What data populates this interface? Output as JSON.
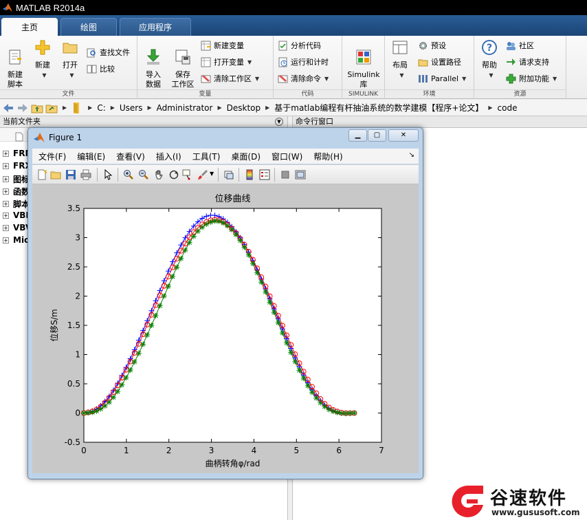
{
  "app": {
    "title": "MATLAB R2014a"
  },
  "tabs": [
    {
      "label": "主页"
    },
    {
      "label": "绘图"
    },
    {
      "label": "应用程序"
    }
  ],
  "ribbon": {
    "file": {
      "label": "文件",
      "new_script": "新建\n脚本",
      "new": "新建",
      "open": "打开",
      "find_files": "查找文件",
      "compare": "比较"
    },
    "variable": {
      "label": "变量",
      "import_data": "导入\n数据",
      "save_workspace": "保存\n工作区",
      "new_variable": "新建变量",
      "open_variable": "打开变量",
      "clear_workspace": "清除工作区"
    },
    "code": {
      "label": "代码",
      "analyze_code": "分析代码",
      "run_and_time": "运行和计时",
      "clear_commands": "清除命令"
    },
    "simulink": {
      "label": "SIMULINK",
      "simulink_library": "Simulink\n库"
    },
    "environment": {
      "label": "环境",
      "layout": "布局",
      "preferences": "预设",
      "set_path": "设置路径",
      "parallel": "Parallel"
    },
    "resources": {
      "label": "资源",
      "help": "帮助",
      "community": "社区",
      "request_support": "请求支持",
      "addons": "附加功能"
    }
  },
  "address": {
    "path": [
      "C:",
      "Users",
      "Administrator",
      "Desktop",
      "基于matlab编程有杆抽油系统的数学建模【程序+论文】",
      "code"
    ]
  },
  "current_folder": {
    "title": "当前文件夹",
    "items": [
      "FRM",
      "FRX",
      "图标",
      "函数",
      "脚本",
      "VBF",
      "VBV",
      "Mic"
    ]
  },
  "command_window": {
    "title": "命令行窗口"
  },
  "figure": {
    "title": "Figure 1",
    "menu": [
      "文件(F)",
      "编辑(E)",
      "查看(V)",
      "插入(I)",
      "工具(T)",
      "桌面(D)",
      "窗口(W)",
      "帮助(H)"
    ]
  },
  "chart_data": {
    "type": "line",
    "title": "位移曲线",
    "xlabel": "曲柄转角φ/rad",
    "ylabel": "位移S/m",
    "xlim": [
      0,
      7
    ],
    "ylim": [
      -0.5,
      3.5
    ],
    "xticks": [
      0,
      1,
      2,
      3,
      4,
      5,
      6,
      7
    ],
    "yticks": [
      -0.5,
      0,
      0.5,
      1,
      1.5,
      2,
      2.5,
      3,
      3.5
    ],
    "grid": false,
    "series": [
      {
        "marker": "+",
        "color": "#0000ff",
        "x": [
          0,
          0.32,
          0.64,
          0.95,
          1.27,
          1.59,
          1.91,
          2.23,
          2.54,
          2.86,
          3.18,
          3.5,
          3.82,
          4.13,
          4.45,
          4.77,
          5.09,
          5.41,
          5.72,
          6.04,
          6.36
        ],
        "y": [
          0,
          0.08,
          0.33,
          0.72,
          1.21,
          1.75,
          2.3,
          2.8,
          3.16,
          3.36,
          3.36,
          3.17,
          2.83,
          2.36,
          1.82,
          1.27,
          0.76,
          0.35,
          0.1,
          0,
          0
        ]
      },
      {
        "marker": "o",
        "color": "#ff0000",
        "x": [
          0,
          0.32,
          0.64,
          0.95,
          1.27,
          1.59,
          1.91,
          2.23,
          2.54,
          2.86,
          3.18,
          3.5,
          3.82,
          4.13,
          4.45,
          4.77,
          5.09,
          5.41,
          5.72,
          6.04,
          6.36
        ],
        "y": [
          0,
          0.07,
          0.3,
          0.68,
          1.15,
          1.68,
          2.21,
          2.7,
          3.06,
          3.26,
          3.3,
          3.14,
          2.83,
          2.39,
          1.87,
          1.33,
          0.82,
          0.4,
          0.12,
          0.01,
          0
        ]
      },
      {
        "marker": "*",
        "color": "#008000",
        "x": [
          0,
          0.32,
          0.64,
          0.95,
          1.27,
          1.59,
          1.91,
          2.23,
          2.54,
          2.86,
          3.18,
          3.5,
          3.82,
          4.13,
          4.45,
          4.77,
          5.09,
          5.41,
          5.72,
          6.04,
          6.36
        ],
        "y": [
          0,
          0.04,
          0.22,
          0.55,
          0.99,
          1.5,
          2.04,
          2.56,
          2.98,
          3.22,
          3.28,
          3.12,
          2.78,
          2.31,
          1.76,
          1.2,
          0.7,
          0.31,
          0.08,
          0,
          0
        ]
      }
    ]
  },
  "watermark": {
    "brand": "谷速软件",
    "url": "www.gususoft.com",
    "accent": "#e8202a"
  }
}
